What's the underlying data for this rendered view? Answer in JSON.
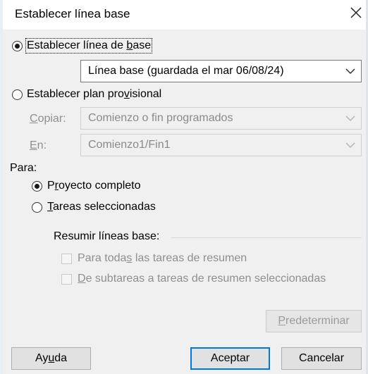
{
  "dialog": {
    "title": "Establecer línea base",
    "close_label": "Cerrar"
  },
  "set_baseline": {
    "label_pre": "Establecer línea de ",
    "label_key": "b",
    "label_post": "ase",
    "checked": true,
    "selected": "Línea base (guardada el mar 06/08/24)"
  },
  "set_interim": {
    "label_pre": "Establecer plan pro",
    "label_key": "v",
    "label_post": "isional",
    "checked": false,
    "copy": {
      "label_key": "C",
      "label_post": "opiar:",
      "value": "Comienzo o fin programados"
    },
    "into": {
      "label_key": "E",
      "label_post": "n:",
      "value": "Comienzo1/Fin1"
    }
  },
  "for": {
    "label": "Para:",
    "entire_project": {
      "label_pre": "P",
      "label_key": "r",
      "label_post": "oyecto completo",
      "checked": true
    },
    "selected_tasks": {
      "label_pre": "",
      "label_key": "T",
      "label_post": "areas seleccionadas",
      "checked": false
    }
  },
  "rollup": {
    "heading": "Resumir líneas base:",
    "all_summary": {
      "label_pre": "Para toda",
      "label_key": "s",
      "label_post": " las tareas de resumen"
    },
    "subtasks": {
      "label_pre": "",
      "label_key": "D",
      "label_post": "e subtareas a tareas de resumen seleccionadas"
    }
  },
  "buttons": {
    "default": {
      "label_key": "P",
      "label_post": "redeterminar"
    },
    "help": {
      "label_pre": "Ay",
      "label_key": "u",
      "label_post": "da"
    },
    "ok": "Aceptar",
    "cancel": "Cancelar"
  }
}
